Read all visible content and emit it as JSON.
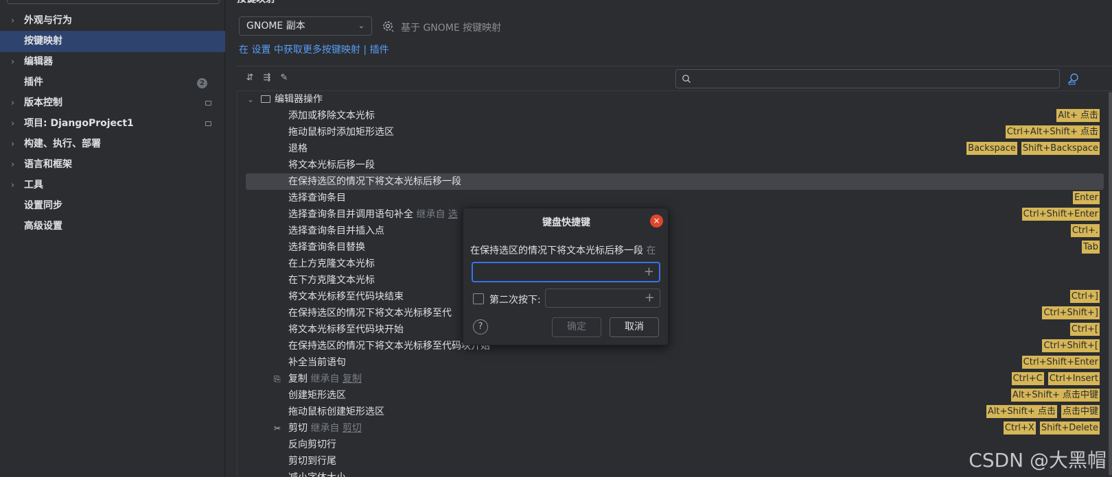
{
  "sidebar": {
    "items": [
      {
        "label": "外观与行为",
        "chevron": true
      },
      {
        "label": "按键映射",
        "selected": true
      },
      {
        "label": "编辑器",
        "chevron": true
      },
      {
        "label": "插件",
        "badge": "2"
      },
      {
        "label": "版本控制",
        "chevron": true,
        "square": true
      },
      {
        "label": "项目: DjangoProject1",
        "chevron": true,
        "square": true
      },
      {
        "label": "构建、执行、部署",
        "chevron": true
      },
      {
        "label": "语言和框架",
        "chevron": true
      },
      {
        "label": "工具",
        "chevron": true
      },
      {
        "label": "设置同步"
      },
      {
        "label": "高级设置"
      }
    ]
  },
  "main": {
    "title": "按键映射",
    "keymap_select": "GNOME 副本",
    "based_on": "基于 GNOME 按键映射",
    "get_more": "在 设置 中获取更多按键映射 | 插件"
  },
  "tree": {
    "folder": "编辑器操作",
    "rows": [
      {
        "label": "添加或移除文本光标",
        "keys": [
          "Alt+ 点击"
        ]
      },
      {
        "label": "拖动鼠标时添加矩形选区",
        "keys": [
          "Ctrl+Alt+Shift+ 点击"
        ]
      },
      {
        "label": "退格",
        "keys": [
          "Backspace",
          "Shift+Backspace"
        ]
      },
      {
        "label": "将文本光标后移一段",
        "keys": []
      },
      {
        "label": "在保持选区的情况下将文本光标后移一段",
        "keys": [],
        "selected": true
      },
      {
        "label": "选择查询条目",
        "keys": [
          "Enter"
        ]
      },
      {
        "label": "选择查询条目并调用语句补全",
        "inherited": "继承自 ",
        "inherited_link": "选",
        "keys": [
          "Ctrl+Shift+Enter"
        ]
      },
      {
        "label": "选择查询条目并插入点",
        "keys": [
          "Ctrl+."
        ]
      },
      {
        "label": "选择查询条目替换",
        "keys": [
          "Tab"
        ]
      },
      {
        "label": "在上方克隆文本光标",
        "keys": []
      },
      {
        "label": "在下方克隆文本光标",
        "keys": []
      },
      {
        "label": "将文本光标移至代码块结束",
        "keys": [
          "Ctrl+]"
        ]
      },
      {
        "label": "在保持选区的情况下将文本光标移至代",
        "keys": [
          "Ctrl+Shift+]"
        ]
      },
      {
        "label": "将文本光标移至代码块开始",
        "keys": [
          "Ctrl+["
        ]
      },
      {
        "label": "在保持选区的情况下将文本光标移至代码块开始",
        "keys": [
          "Ctrl+Shift+["
        ]
      },
      {
        "label": "补全当前语句",
        "keys": [
          "Ctrl+Shift+Enter"
        ]
      },
      {
        "label": "复制",
        "icon": "copy",
        "inherited": "继承自 ",
        "inherited_link": "复制",
        "keys": [
          "Ctrl+C",
          "Ctrl+Insert"
        ]
      },
      {
        "label": "创建矩形选区",
        "keys": [
          "Alt+Shift+ 点击中键"
        ]
      },
      {
        "label": "拖动鼠标创建矩形选区",
        "keys": [
          "Alt+Shift+ 点击",
          "点击中键"
        ]
      },
      {
        "label": "剪切",
        "icon": "cut",
        "inherited": "继承自 ",
        "inherited_link": "剪切",
        "keys": [
          "Ctrl+X",
          "Shift+Delete"
        ]
      },
      {
        "label": "反向剪切行",
        "keys": []
      },
      {
        "label": "剪切到行尾",
        "keys": []
      },
      {
        "label": "减小字体大小",
        "keys": []
      }
    ]
  },
  "dialog": {
    "title": "键盘快捷键",
    "action": "在保持选区的情况下将文本光标后移一段",
    "action_inherited": " 在",
    "second_label": "第二次按下:",
    "ok": "确定",
    "cancel": "取消",
    "help": "?",
    "close": "×"
  },
  "watermark": "CSDN @大黑帽",
  "colors": {
    "accent": "#3574f0",
    "link": "#589df6",
    "shortcut_badge": "#d6b656",
    "selection": "#2e436e",
    "close": "#e0462f"
  }
}
